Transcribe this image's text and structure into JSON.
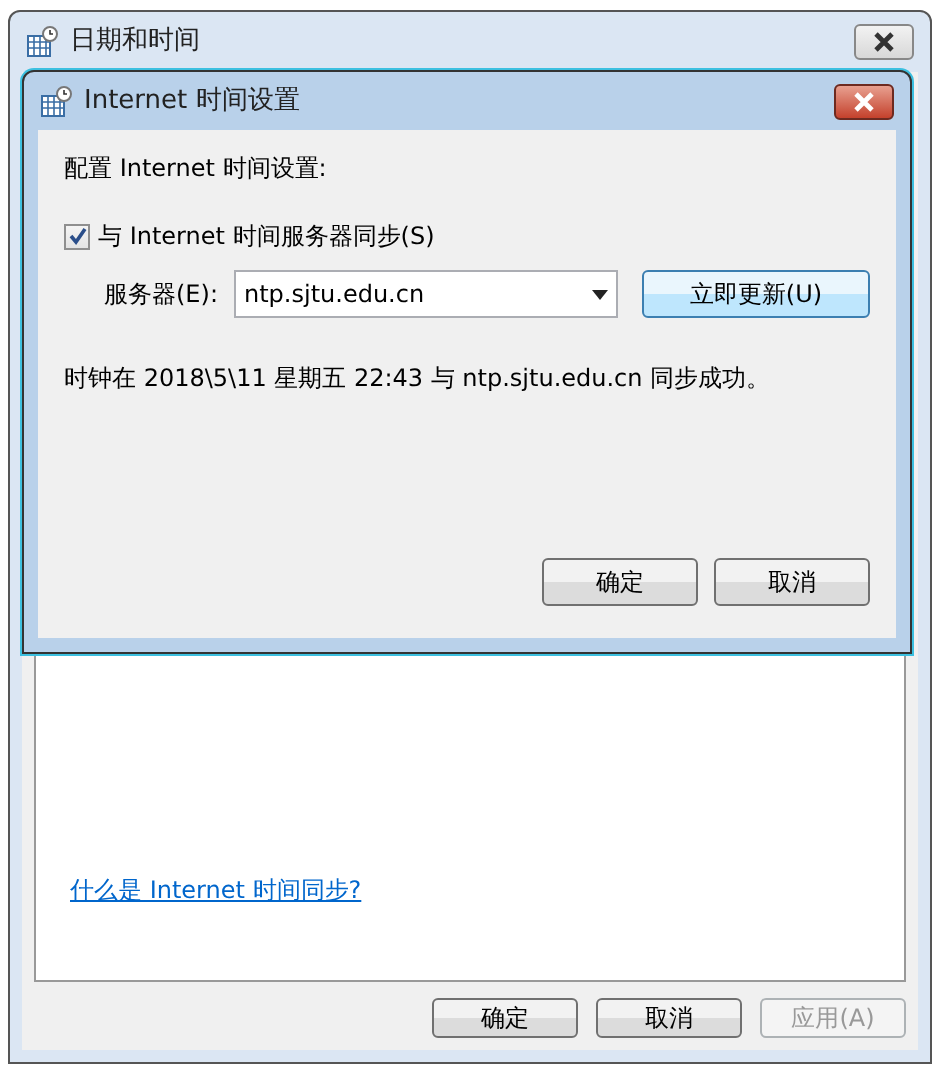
{
  "outer_window": {
    "title": "日期和时间",
    "link": "什么是 Internet 时间同步?",
    "buttons": [
      {
        "label": "确定",
        "disabled": false
      },
      {
        "label": "取消",
        "disabled": false
      },
      {
        "label": "应用(A)",
        "disabled": true
      }
    ]
  },
  "dialog": {
    "title": "Internet 时间设置",
    "heading": "配置 Internet 时间设置:",
    "sync_checkbox": {
      "label": "与 Internet 时间服务器同步(S)",
      "checked": true
    },
    "server": {
      "label": "服务器(E):",
      "value": "ntp.sjtu.edu.cn"
    },
    "update_button": "立即更新(U)",
    "status": "时钟在 2018\\5\\11 星期五 22:43 与 ntp.sjtu.edu.cn 同步成功。",
    "buttons": [
      "确定",
      "取消"
    ]
  }
}
